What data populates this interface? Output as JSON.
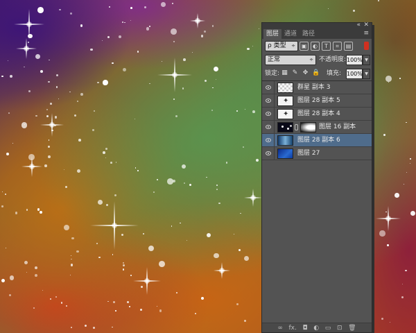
{
  "panel": {
    "tabs": [
      {
        "label": "图层",
        "active": true
      },
      {
        "label": "通道",
        "active": false
      },
      {
        "label": "路径",
        "active": false
      }
    ],
    "filter": {
      "label": "ρ 类型",
      "arrow": "÷"
    },
    "blend_mode": "正常",
    "opacity": {
      "label": "不透明度:",
      "value": "100%"
    },
    "lock_label": "锁定:",
    "fill": {
      "label": "填充:",
      "value": "100%"
    },
    "layers": [
      {
        "name": "群星 副本 3",
        "thumb": "trans",
        "selected": false,
        "mask": false
      },
      {
        "name": "图层 28 副本 5",
        "thumb": "stars",
        "selected": false,
        "mask": false
      },
      {
        "name": "图层 28 副本 4",
        "thumb": "stars",
        "selected": false,
        "mask": false
      },
      {
        "name": "图层 16 副本",
        "thumb": "dark",
        "selected": false,
        "mask": true
      },
      {
        "name": "图层 28 副本 6",
        "thumb": "nebula",
        "selected": true,
        "mask": false
      },
      {
        "name": "图层 27",
        "thumb": "blue",
        "selected": false,
        "mask": false
      }
    ],
    "footer_icons": [
      "link-icon",
      "fx-icon",
      "mask-icon",
      "adjustment-icon",
      "group-icon",
      "new-layer-icon",
      "trash-icon"
    ],
    "footer_glyphs": [
      "∞",
      "fx.",
      "◘",
      "◐",
      "▭",
      "⊡",
      "🗑"
    ],
    "selected_color": "#4f6c8b",
    "panel_color": "#535353"
  }
}
